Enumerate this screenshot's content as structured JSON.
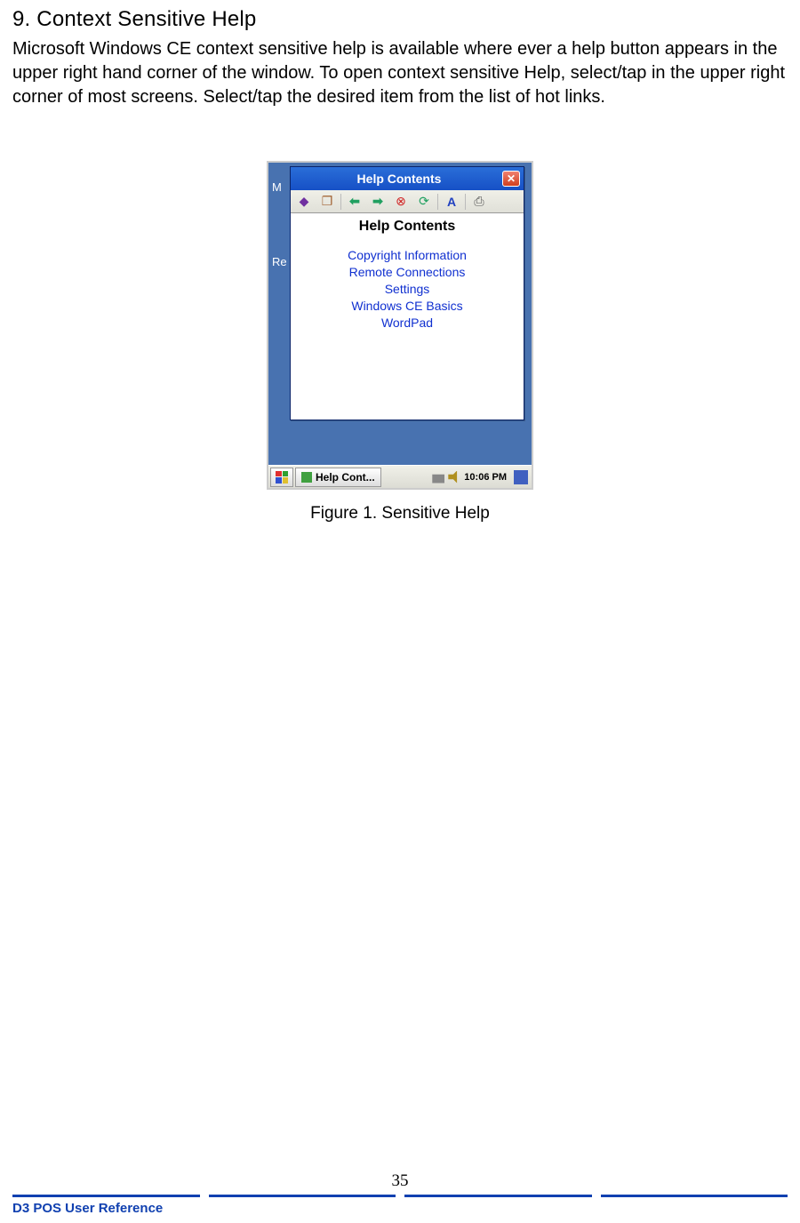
{
  "heading": "9. Context Sensitive Help",
  "paragraph": "Microsoft Windows CE context sensitive help is available where ever a help button appears in the upper right hand corner of the window. To open context sensitive Help, select/tap in the upper right corner of most screens. Select/tap the desired item from the list of hot links.",
  "window": {
    "title": "Help Contents",
    "body_title": "Help Contents",
    "links": [
      "Copyright Information",
      "Remote Connections",
      "Settings",
      "Windows CE Basics",
      "WordPad"
    ]
  },
  "side_labels": {
    "m": "M",
    "r": "Re"
  },
  "taskbar": {
    "task_label": "Help Cont...",
    "time": "10:06 PM"
  },
  "figure_caption": "Figure 1. Sensitive Help",
  "page_number": "35",
  "footer_title": "D3 POS User Reference"
}
